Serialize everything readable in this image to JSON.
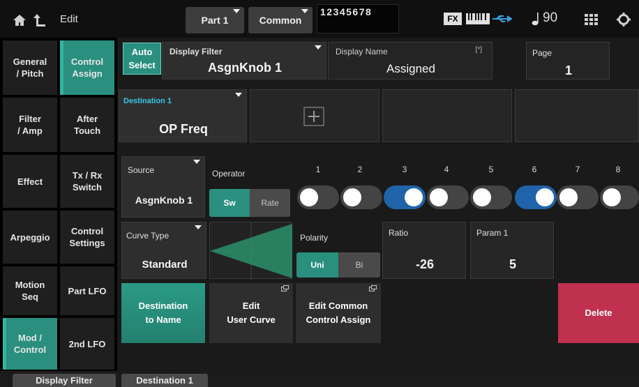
{
  "topbar": {
    "title": "Edit",
    "part_label": "Part 1",
    "common_label": "Common",
    "part_numbers": "12345678",
    "fx_label": "FX",
    "tempo": "90"
  },
  "nav_left": [
    {
      "label": "General\n/ Pitch",
      "active": false
    },
    {
      "label": "Filter\n/ Amp",
      "active": false
    },
    {
      "label": "Effect",
      "active": false
    },
    {
      "label": "Arpeggio",
      "active": false
    },
    {
      "label": "Motion\nSeq",
      "active": false
    },
    {
      "label": "Mod /\nControl",
      "active": true
    }
  ],
  "nav_right": [
    {
      "label": "Control\nAssign",
      "active": true
    },
    {
      "label": "After\nTouch",
      "active": false
    },
    {
      "label": "Tx / Rx\nSwitch",
      "active": false
    },
    {
      "label": "Control\nSettings",
      "active": false
    },
    {
      "label": "Part LFO",
      "active": false
    },
    {
      "label": "2nd LFO",
      "active": false
    }
  ],
  "header": {
    "auto_select": "Auto\nSelect",
    "display_filter_label": "Display Filter",
    "display_filter_value": "AsgnKnob 1",
    "display_name_label": "Display Name",
    "display_name_badge": "[*]",
    "display_name_value": "Assigned",
    "page_label": "Page",
    "page_value": "1"
  },
  "destination": {
    "label": "Destination 1",
    "value": "OP Freq"
  },
  "source": {
    "label": "Source",
    "value": "AsgnKnob 1"
  },
  "operator": {
    "label": "Operator",
    "mode_options": [
      "Sw",
      "Rate"
    ],
    "mode_selected": "Sw",
    "numbers": [
      "1",
      "2",
      "3",
      "4",
      "5",
      "6",
      "7",
      "8"
    ],
    "states": [
      false,
      false,
      true,
      false,
      false,
      true,
      false,
      false
    ]
  },
  "curve": {
    "label": "Curve Type",
    "value": "Standard"
  },
  "polarity": {
    "label": "Polarity",
    "options": [
      "Uni",
      "Bi"
    ],
    "selected": "Uni"
  },
  "ratio": {
    "label": "Ratio",
    "value": "-26"
  },
  "param1": {
    "label": "Param 1",
    "value": "5"
  },
  "buttons": {
    "dest_to_name": "Destination\nto Name",
    "edit_user_curve": "Edit\nUser Curve",
    "edit_common": "Edit Common\nControl Assign",
    "delete": "Delete"
  },
  "bottom_tabs": [
    "Display Filter",
    "Destination 1"
  ],
  "colors": {
    "accent_teal": "#2a8f7f",
    "switch_on": "#1f63a8",
    "delete_red": "#c0304f",
    "cyan_label": "#38c8e8"
  }
}
